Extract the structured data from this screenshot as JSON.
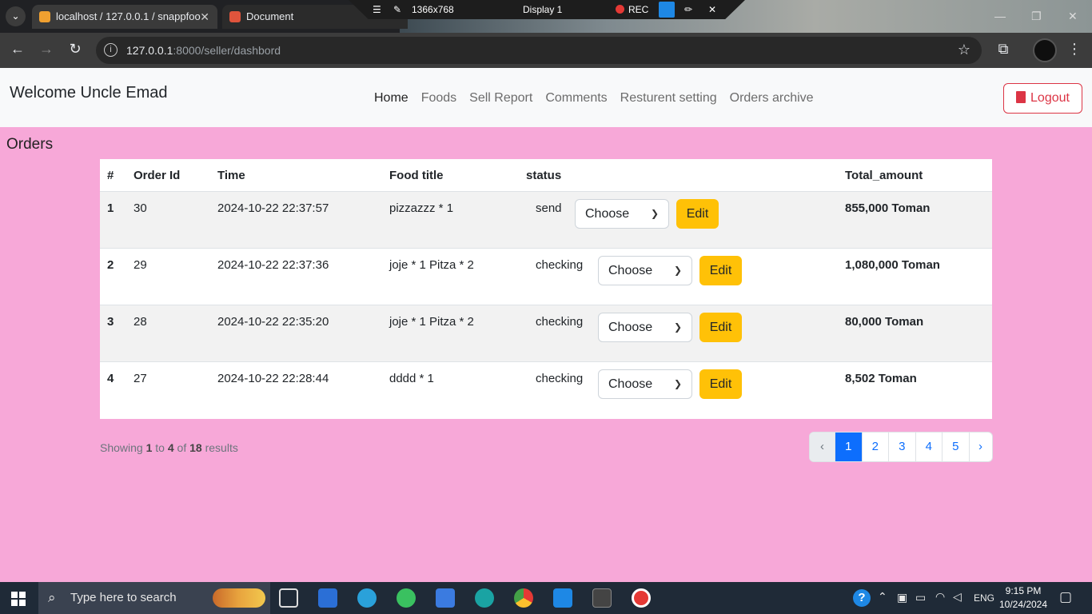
{
  "browser": {
    "tabs": [
      {
        "title": "localhost / 127.0.0.1 / snappfoo"
      },
      {
        "title": "Document"
      }
    ],
    "recorder": {
      "resolution": "1366x768",
      "display": "Display 1",
      "rec_label": "REC"
    },
    "url_host": "127.0.0.1",
    "url_path": ":8000/seller/dashbord"
  },
  "navbar": {
    "brand": "Welcome Uncle Emad",
    "links": [
      "Home",
      "Foods",
      "Sell Report",
      "Comments",
      "Resturent setting",
      "Orders archive"
    ],
    "active_link": "Home",
    "logout_label": "Logout"
  },
  "orders": {
    "title": "Orders",
    "headers": {
      "num": "#",
      "order_id": "Order Id",
      "time": "Time",
      "food": "Food title",
      "status": "status",
      "total": "Total_amount"
    },
    "select_placeholder": "Choose",
    "edit_label": "Edit",
    "rows": [
      {
        "num": "1",
        "order_id": "30",
        "time": "2024-10-22 22:37:57",
        "food": "pizzazzz * 1",
        "status": "send",
        "total": "855,000 Toman"
      },
      {
        "num": "2",
        "order_id": "29",
        "time": "2024-10-22 22:37:36",
        "food": "joje * 1 Pitza * 2",
        "status": "checking",
        "total": "1,080,000 Toman"
      },
      {
        "num": "3",
        "order_id": "28",
        "time": "2024-10-22 22:35:20",
        "food": "joje * 1 Pitza * 2",
        "status": "checking",
        "total": "80,000 Toman"
      },
      {
        "num": "4",
        "order_id": "27",
        "time": "2024-10-22 22:28:44",
        "food": "dddd * 1",
        "status": "checking",
        "total": "8,502 Toman"
      }
    ]
  },
  "pagination": {
    "showing_prefix": "Showing",
    "from": "1",
    "to_word": "to",
    "to": "4",
    "of_word": "of",
    "total": "18",
    "suffix": "results",
    "prev": "‹",
    "next": "›",
    "pages": [
      "1",
      "2",
      "3",
      "4",
      "5"
    ],
    "current_page": "1"
  },
  "taskbar": {
    "search_placeholder": "Type here to search",
    "language": "ENG",
    "time": "9:15 PM",
    "date": "10/24/2024"
  }
}
